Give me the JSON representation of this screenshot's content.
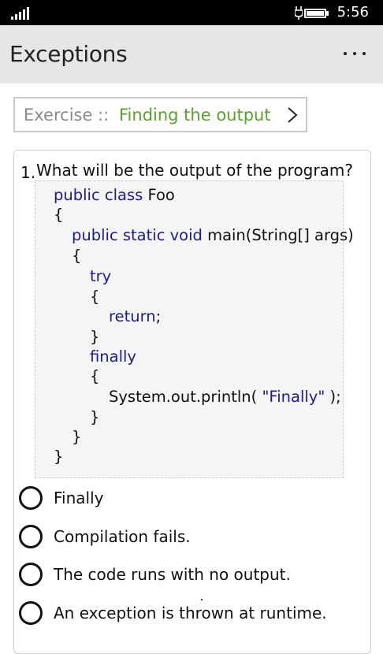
{
  "status_bar": {
    "time": "5:56",
    "icons": [
      "signal-strength-icon",
      "battery-charging-icon"
    ]
  },
  "header": {
    "title": "Exceptions",
    "more_icon": "ellipsis-icon"
  },
  "exercise": {
    "prefix": "Exercise ::",
    "name": "Finding the output",
    "chevron_icon": "chevron-right-icon"
  },
  "question": {
    "number": "1.",
    "text": "What will be the output of the program?",
    "code": {
      "l1_kw": "public class",
      "l1_rest": " Foo",
      "l2": "{",
      "l3_kw": "public static void",
      "l3_rest": " main(String[] args)",
      "l4": "{",
      "l5_kw": "try",
      "l6": "{",
      "l7_kw": "return",
      "l7_rest": ";",
      "l8": "}",
      "l9_kw": "finally",
      "l10": "{",
      "l11_pre": "System.out.println( ",
      "l11_str": "\"Finally\"",
      "l11_post": " );",
      "l12": "}",
      "l13": "}",
      "l14": "}"
    }
  },
  "options": [
    {
      "label": "Finally"
    },
    {
      "label": "Compilation fails."
    },
    {
      "label": "The code runs with no output."
    },
    {
      "label": "An exception is thrown at runtime."
    }
  ],
  "colors": {
    "keyword": "#1c1c8a",
    "exercise_name": "#5aa02c",
    "header_bg": "#e6e6e6"
  }
}
